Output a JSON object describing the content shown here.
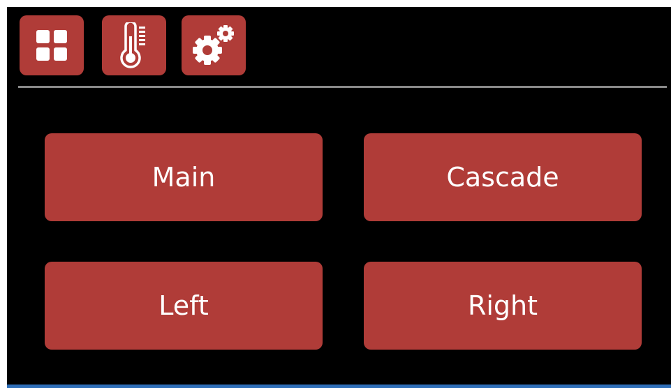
{
  "toolbar": {
    "icons": [
      {
        "name": "dashboard-grid-icon"
      },
      {
        "name": "thermometer-icon"
      },
      {
        "name": "gear-icon"
      }
    ]
  },
  "buttons": {
    "main": "Main",
    "cascade": "Cascade",
    "left": "Left",
    "right": "Right"
  },
  "colors": {
    "background": "#000000",
    "accent": "#b03c38",
    "divider": "#8a8a8a",
    "text": "#ffffff"
  }
}
